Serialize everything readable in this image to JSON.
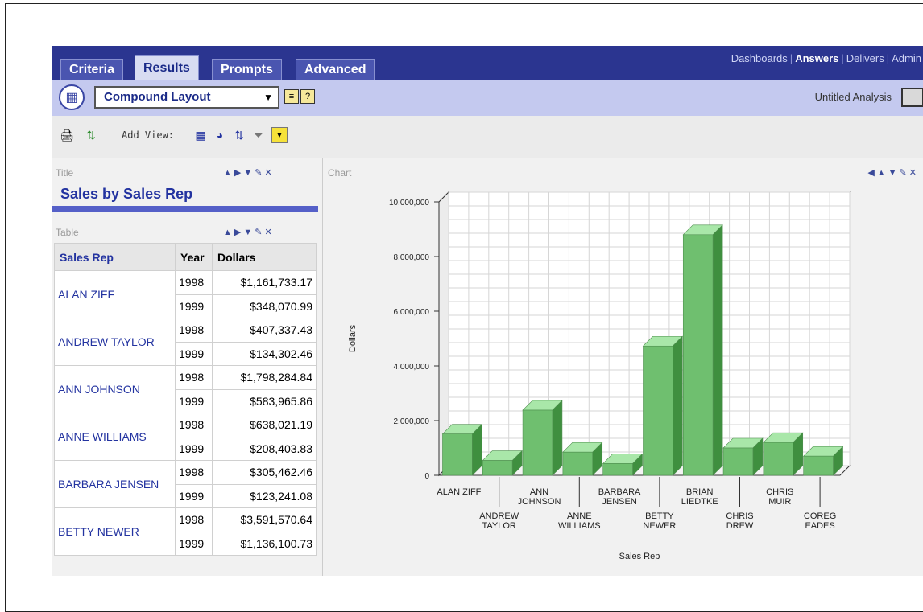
{
  "tabs": [
    {
      "label": "Criteria"
    },
    {
      "label": "Results"
    },
    {
      "label": "Prompts"
    },
    {
      "label": "Advanced"
    }
  ],
  "top_links": [
    "Dashboards",
    "Answers",
    "Delivers",
    "Admin"
  ],
  "layout": {
    "select_value": "Compound Layout",
    "untitled": "Untitled Analysis"
  },
  "add_view": {
    "label": "Add View:"
  },
  "title_panel": {
    "label": "Title",
    "title": "Sales by Sales Rep"
  },
  "table_panel": {
    "label": "Table",
    "headers": [
      "Sales Rep",
      "Year",
      "Dollars"
    ],
    "groups": [
      {
        "rep": "ALAN ZIFF",
        "rows": [
          {
            "year": "1998",
            "dollars": "$1,161,733.17"
          },
          {
            "year": "1999",
            "dollars": "$348,070.99"
          }
        ]
      },
      {
        "rep": "ANDREW TAYLOR",
        "rows": [
          {
            "year": "1998",
            "dollars": "$407,337.43"
          },
          {
            "year": "1999",
            "dollars": "$134,302.46"
          }
        ]
      },
      {
        "rep": "ANN JOHNSON",
        "rows": [
          {
            "year": "1998",
            "dollars": "$1,798,284.84"
          },
          {
            "year": "1999",
            "dollars": "$583,965.86"
          }
        ]
      },
      {
        "rep": "ANNE WILLIAMS",
        "rows": [
          {
            "year": "1998",
            "dollars": "$638,021.19"
          },
          {
            "year": "1999",
            "dollars": "$208,403.83"
          }
        ]
      },
      {
        "rep": "BARBARA JENSEN",
        "rows": [
          {
            "year": "1998",
            "dollars": "$305,462.46"
          },
          {
            "year": "1999",
            "dollars": "$123,241.08"
          }
        ]
      },
      {
        "rep": "BETTY NEWER",
        "rows": [
          {
            "year": "1998",
            "dollars": "$3,591,570.64"
          },
          {
            "year": "1999",
            "dollars": "$1,136,100.73"
          }
        ]
      }
    ]
  },
  "chart_panel": {
    "label": "Chart"
  },
  "chart_data": {
    "type": "bar",
    "categories": [
      "ALAN ZIFF",
      "ANDREW TAYLOR",
      "ANN JOHNSON",
      "ANNE WILLIAMS",
      "BARBARA JENSEN",
      "BETTY NEWER",
      "BRIAN LIEDTKE",
      "CHRIS DREW",
      "CHRIS MUIR",
      "COREG EADES"
    ],
    "values": [
      1509804,
      541640,
      2382251,
      846425,
      428704,
      4727671,
      8800000,
      1000000,
      1200000,
      700000
    ],
    "xlabel": "Sales Rep",
    "ylabel": "Dollars",
    "ylim": [
      0,
      10000000
    ],
    "yticks": [
      "0",
      "2,000,000",
      "4,000,000",
      "6,000,000",
      "8,000,000",
      "10,000,000"
    ],
    "grid": true,
    "bar_color": "#6fbf6f"
  }
}
